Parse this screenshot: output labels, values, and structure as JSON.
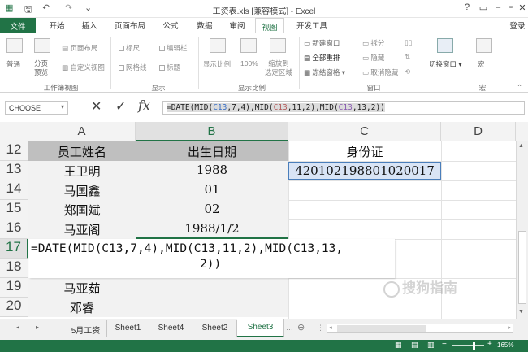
{
  "window": {
    "title": "工资表.xls [兼容模式] - Excel",
    "controls": [
      "?",
      "▭",
      "–",
      "▫",
      "✕"
    ]
  },
  "tabs": [
    "文件",
    "开始",
    "插入",
    "页面布局",
    "公式",
    "数据",
    "审阅",
    "视图",
    "开发工具"
  ],
  "login_label": "登录",
  "ribbon": {
    "normal": "普通",
    "page_break": "分页\n预览",
    "page_layout": "页面布局",
    "custom_view": "自定义视图",
    "ruler": "标尺",
    "formula_bar": "编辑栏",
    "gridlines": "网格线",
    "headings": "标题",
    "zoom": "显示比例",
    "zoom100": "100%",
    "zoom_selection": "缩放到\n选定区域",
    "new_window": "新建窗口",
    "arrange_all": "全部重排",
    "freeze": "冻结窗格",
    "split": "拆分",
    "hide": "隐藏",
    "unhide": "取消隐藏",
    "switch_window": "切换窗口",
    "macro": "宏",
    "groups": [
      "工作簿视图",
      "显示",
      "显示比例",
      "窗口",
      "宏"
    ]
  },
  "name_box": "CHOOSE",
  "formula": {
    "prefix": "=DATE(MID(",
    "r1": "C13",
    "m1": ",7,4),MID(",
    "r2": "C13",
    "m2": ",11,2),MID(",
    "r3": "C13",
    "suffix": ",13,2))"
  },
  "columns": [
    "A",
    "B",
    "C",
    "D"
  ],
  "rows": [
    "12",
    "13",
    "14",
    "15",
    "16",
    "17",
    "18",
    "19",
    "20"
  ],
  "cells": {
    "A12": "员工姓名",
    "B12": "出生日期",
    "C12": "身份证",
    "A13": "王卫明",
    "B13": "1988",
    "C13": "420102198801020017",
    "A14": "马国鑫",
    "B14": "01",
    "A15": "郑国斌",
    "B15": "02",
    "A16": "马亚阁",
    "B16": "1988/1/2",
    "edit17": "=DATE(MID(C13,7,4),MID(C13,11,2),MID(C13,13,",
    "edit18": "2))",
    "A19": "马亚茹",
    "A20": "邓睿"
  },
  "sheets": [
    "5月工资",
    "Sheet1",
    "Sheet4",
    "Sheet2",
    "Sheet3"
  ],
  "status": {
    "mode": "",
    "zoom": "165%"
  },
  "watermark": "搜狗指南",
  "colors": {
    "accent": "#217346",
    "header_fill": "#bfbfbf",
    "selected_cell": "#d9e4f5"
  }
}
